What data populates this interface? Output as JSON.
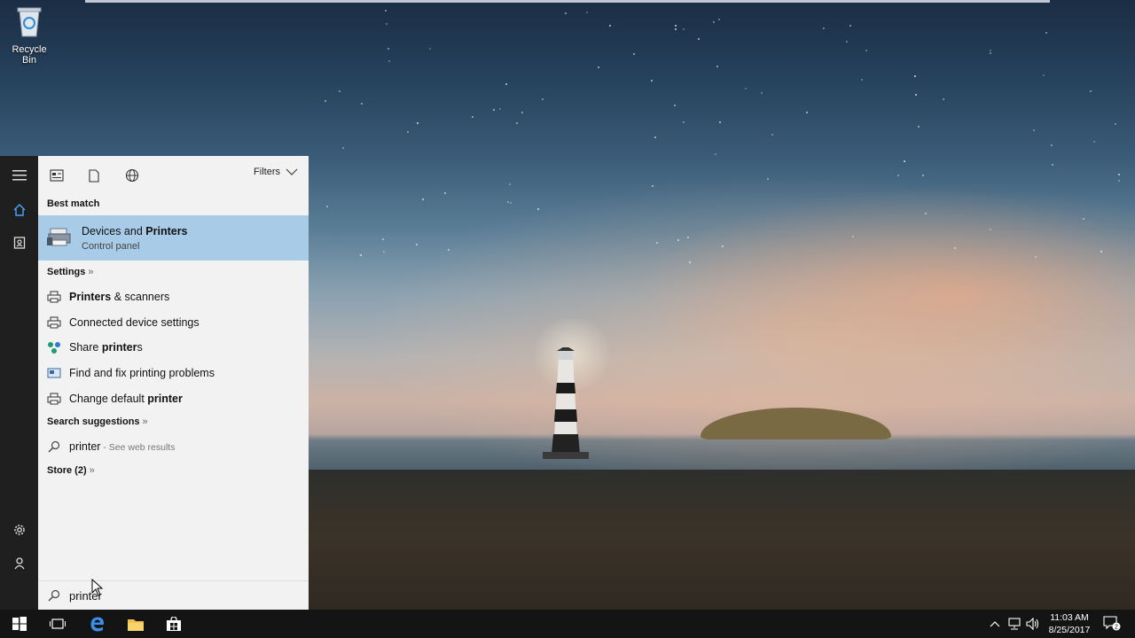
{
  "desktop": {
    "recycle_bin_label": "Recycle Bin"
  },
  "start_rail": {
    "items": [
      "hamburger-menu",
      "home",
      "notebook",
      "settings",
      "feedback"
    ]
  },
  "search_panel": {
    "filters_label": "Filters",
    "best_match_heading": "Best match",
    "best_match": {
      "title_normal": "Devices and ",
      "title_bold": "Printers",
      "subtitle": "Control panel"
    },
    "settings_heading": "Settings",
    "settings_items": [
      {
        "pre": "",
        "bold": "Printers",
        "post": " & scanners"
      },
      {
        "pre": "Connected device settings",
        "bold": "",
        "post": ""
      },
      {
        "pre": "Share ",
        "bold": "printer",
        "post": "s"
      },
      {
        "pre": "Find and fix printing problems",
        "bold": "",
        "post": ""
      },
      {
        "pre": "Change default ",
        "bold": "printer",
        "post": ""
      }
    ],
    "suggestions_heading": "Search suggestions",
    "suggestion": {
      "query": "printer",
      "hint": " - See web results"
    },
    "store_heading": "Store (2)",
    "section_chevron": "»",
    "search_query": "printer"
  },
  "taskbar": {
    "time": "11:03 AM",
    "date": "8/25/2017",
    "notification_count": "2"
  }
}
